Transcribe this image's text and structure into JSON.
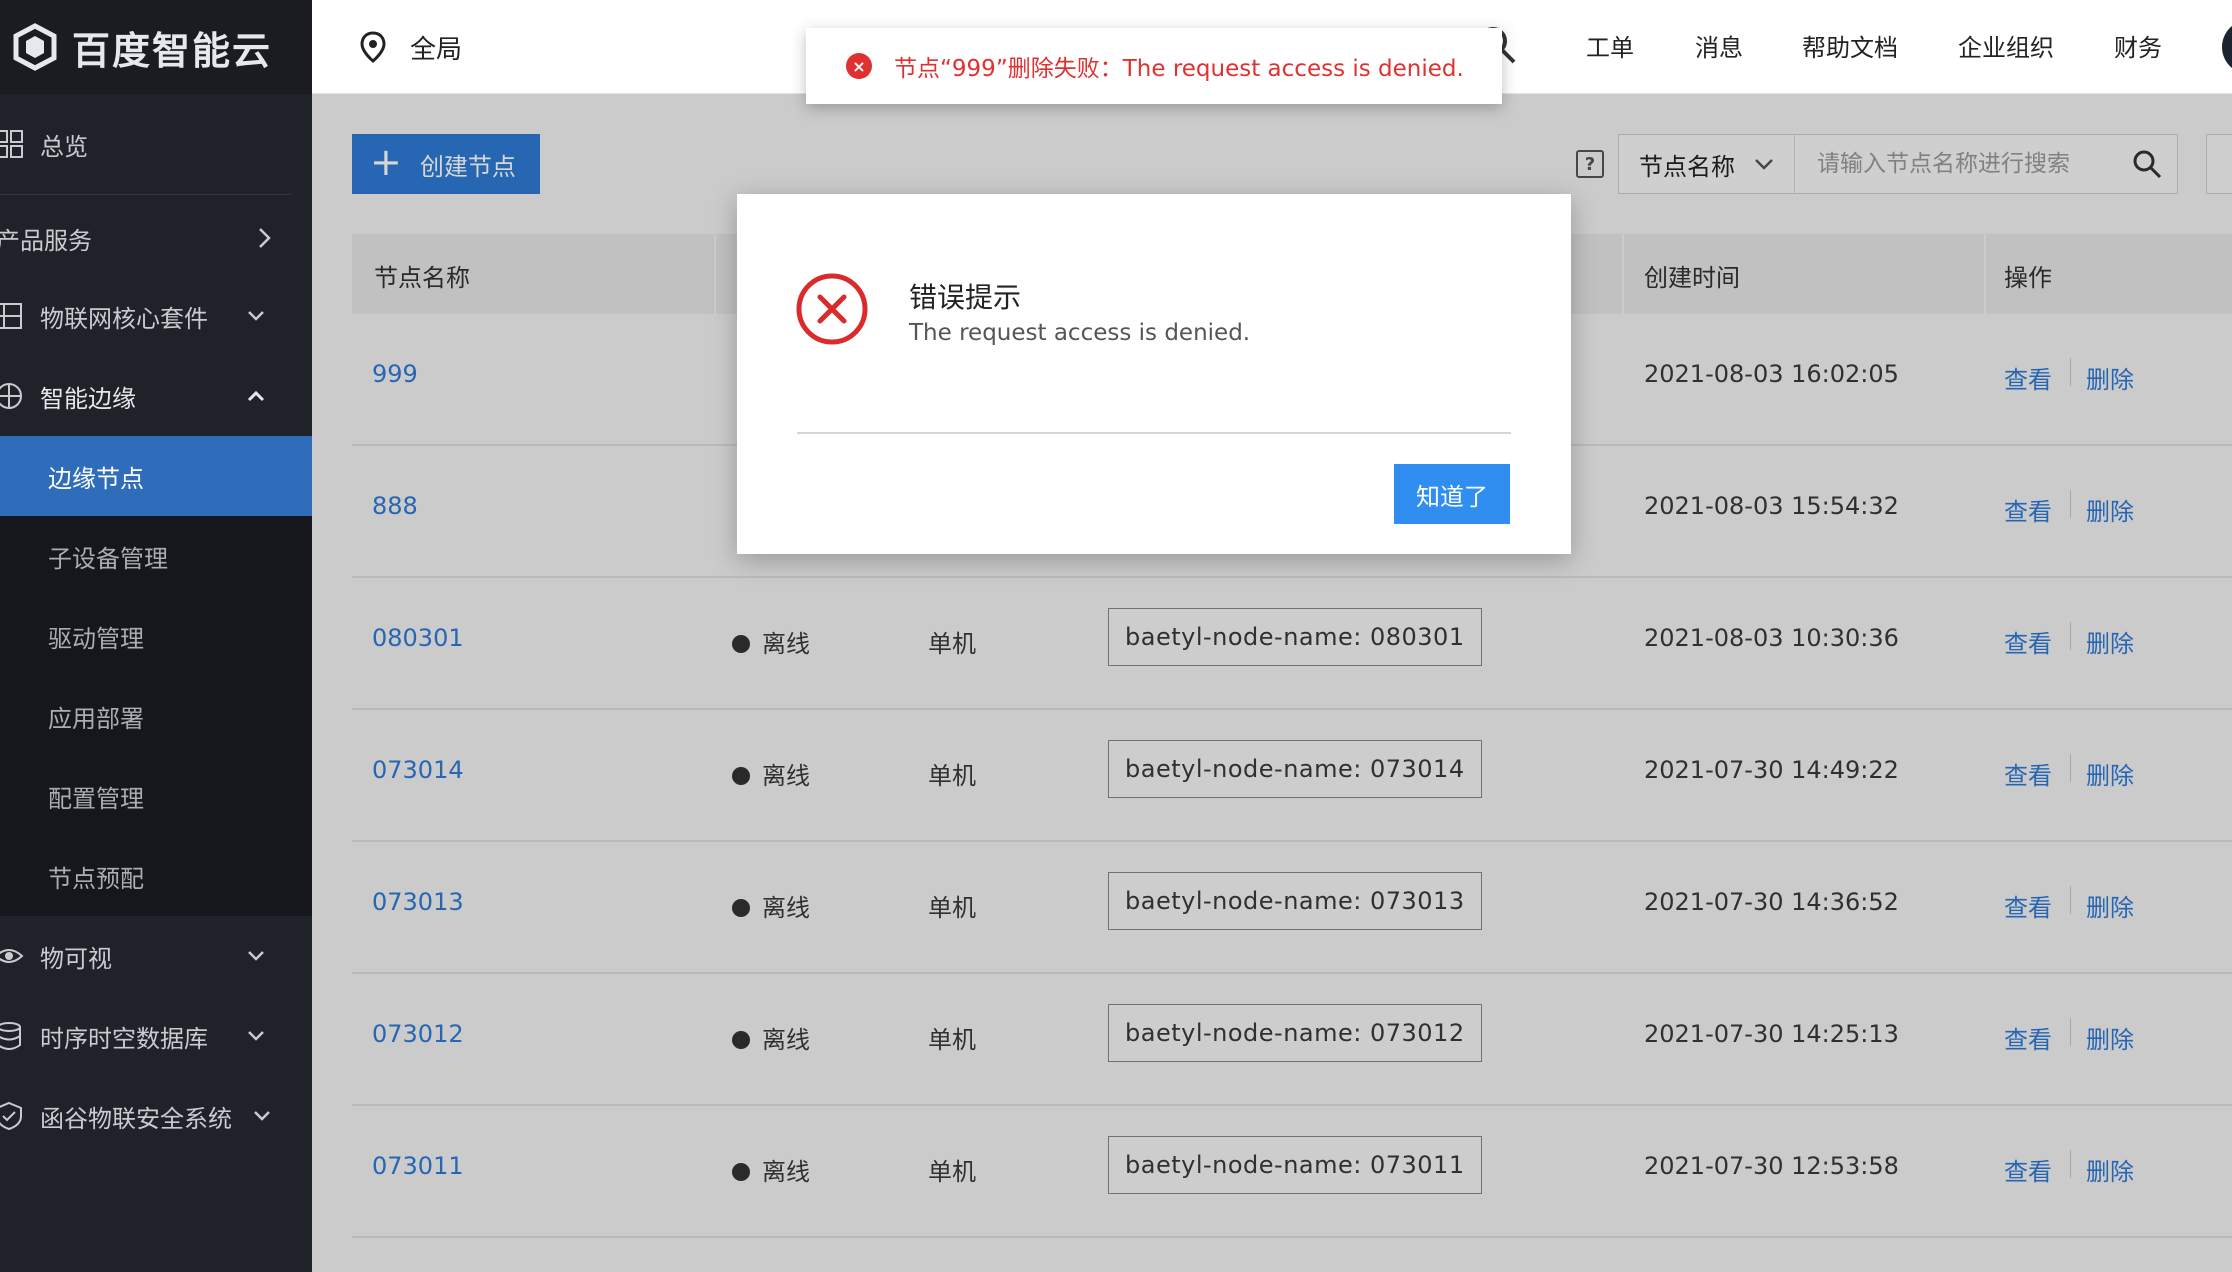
{
  "logo": {
    "text": "百度智能云"
  },
  "sidebar": {
    "overview": "总览",
    "products": "产品服务",
    "iot_core": "物联网核心套件",
    "edge": "智能边缘",
    "edge_sub": [
      "边缘节点",
      "子设备管理",
      "驱动管理",
      "应用部署",
      "配置管理",
      "节点预配"
    ],
    "visual": "物可视",
    "tsdb": "时序时空数据库",
    "security": "函谷物联安全系统"
  },
  "header": {
    "region": "全局",
    "nav": [
      "工单",
      "消息",
      "帮助文档",
      "企业组织",
      "财务"
    ]
  },
  "toolbar": {
    "create_label": "创建节点",
    "help": "?",
    "search_field": "节点名称",
    "search_placeholder": "请输入节点名称进行搜索"
  },
  "table": {
    "headers": {
      "name": "节点名称",
      "created": "创建时间",
      "ops": "操作"
    },
    "rows": [
      {
        "name": "999",
        "status": "",
        "mode": "",
        "tag": "",
        "created": "2021-08-03 16:02:05"
      },
      {
        "name": "888",
        "status": "",
        "mode": "",
        "tag": "",
        "created": "2021-08-03 15:54:32"
      },
      {
        "name": "080301",
        "status": "离线",
        "mode": "单机",
        "tag": "baetyl-node-name: 080301",
        "created": "2021-08-03 10:30:36"
      },
      {
        "name": "073014",
        "status": "离线",
        "mode": "单机",
        "tag": "baetyl-node-name: 073014",
        "created": "2021-07-30 14:49:22"
      },
      {
        "name": "073013",
        "status": "离线",
        "mode": "单机",
        "tag": "baetyl-node-name: 073013",
        "created": "2021-07-30 14:36:52"
      },
      {
        "name": "073012",
        "status": "离线",
        "mode": "单机",
        "tag": "baetyl-node-name: 073012",
        "created": "2021-07-30 14:25:13"
      },
      {
        "name": "073011",
        "status": "离线",
        "mode": "单机",
        "tag": "baetyl-node-name: 073011",
        "created": "2021-07-30 12:53:58"
      }
    ],
    "op_view": "查看",
    "op_delete": "删除"
  },
  "toast": {
    "text": "节点“999”删除失败：The request access is denied."
  },
  "modal": {
    "title": "错误提示",
    "message": "The request access is denied.",
    "confirm": "知道了"
  },
  "colors": {
    "brand": "#2f7ad6",
    "error": "#e03131",
    "sidebar_bg": "#1f2229",
    "active_item": "#2f6dbb"
  },
  "icons": [
    "location-pin-icon",
    "search-icon",
    "plus-icon",
    "chevron-down-icon",
    "chevron-right-icon",
    "chevron-up-icon",
    "error-circle-icon",
    "grid-icon",
    "network-icon",
    "edge-icon",
    "eye-icon",
    "database-icon",
    "shield-icon"
  ]
}
